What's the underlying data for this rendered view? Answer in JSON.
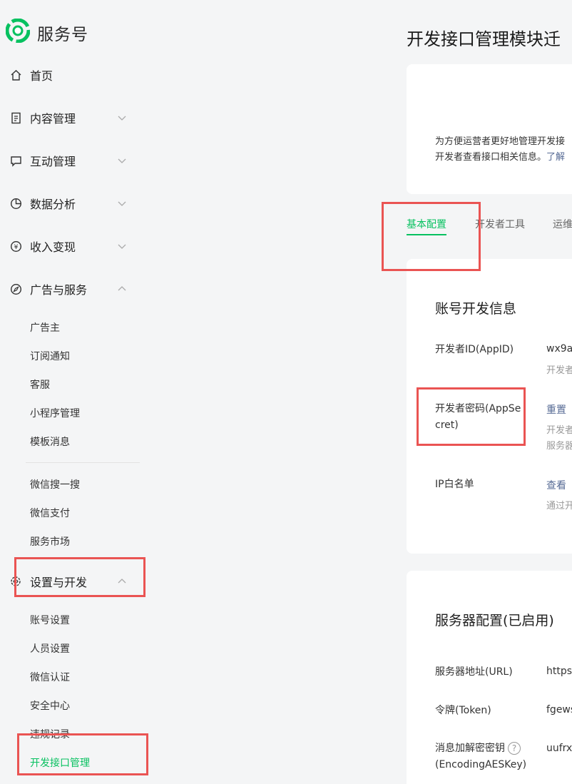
{
  "brand": {
    "name": "服务号"
  },
  "sidebar": {
    "top_items": [
      {
        "label": "首页",
        "icon": "home-icon"
      },
      {
        "label": "内容管理",
        "icon": "document-icon",
        "expanded": false
      },
      {
        "label": "互动管理",
        "icon": "chat-icon",
        "expanded": false
      },
      {
        "label": "数据分析",
        "icon": "pie-chart-icon",
        "expanded": false
      },
      {
        "label": "收入变现",
        "icon": "yen-icon",
        "expanded": false
      },
      {
        "label": "广告与服务",
        "icon": "compass-icon",
        "expanded": true
      },
      {
        "label": "设置与开发",
        "icon": "code-gear-icon",
        "expanded": true
      }
    ],
    "ads_items": [
      "广告主",
      "订阅通知",
      "客服",
      "小程序管理",
      "模板消息",
      "微信搜一搜",
      "微信支付",
      "服务市场"
    ],
    "settings_items": [
      "账号设置",
      "人员设置",
      "微信认证",
      "安全中心",
      "违规记录",
      "开发接口管理"
    ],
    "active_item": "开发接口管理"
  },
  "page": {
    "title": "开发接口管理模块迁"
  },
  "intro": {
    "line1": "为方便运营者更好地管理开发接",
    "line2": "开发者查看接口相关信息。",
    "link": "了解"
  },
  "tabs": [
    {
      "label": "基本配置",
      "active": true
    },
    {
      "label": "开发者工具",
      "active": false
    },
    {
      "label": "运维",
      "active": false
    }
  ],
  "account_dev": {
    "title": "账号开发信息",
    "appid": {
      "label": "开发者ID(AppID)",
      "value": "wx9a",
      "note": "开发者"
    },
    "secret": {
      "label": "开发者密码(AppSecret)",
      "action": "重置",
      "note1": "开发者",
      "note2": "服务器"
    },
    "ip": {
      "label": "IP白名单",
      "action": "查看",
      "note": "通过开"
    }
  },
  "server": {
    "title": "服务器配置(已启用)",
    "url": {
      "label": "服务器地址(URL)",
      "value": "https:"
    },
    "token": {
      "label": "令牌(Token)",
      "value": "fgews"
    },
    "aes": {
      "label": "消息加解密密钥",
      "label2": "(EncodingAESKey)",
      "help": "?",
      "value": "uufrx"
    }
  },
  "colors": {
    "accent": "#07c160",
    "highlight": "#ea5453",
    "link": "#576b95"
  }
}
